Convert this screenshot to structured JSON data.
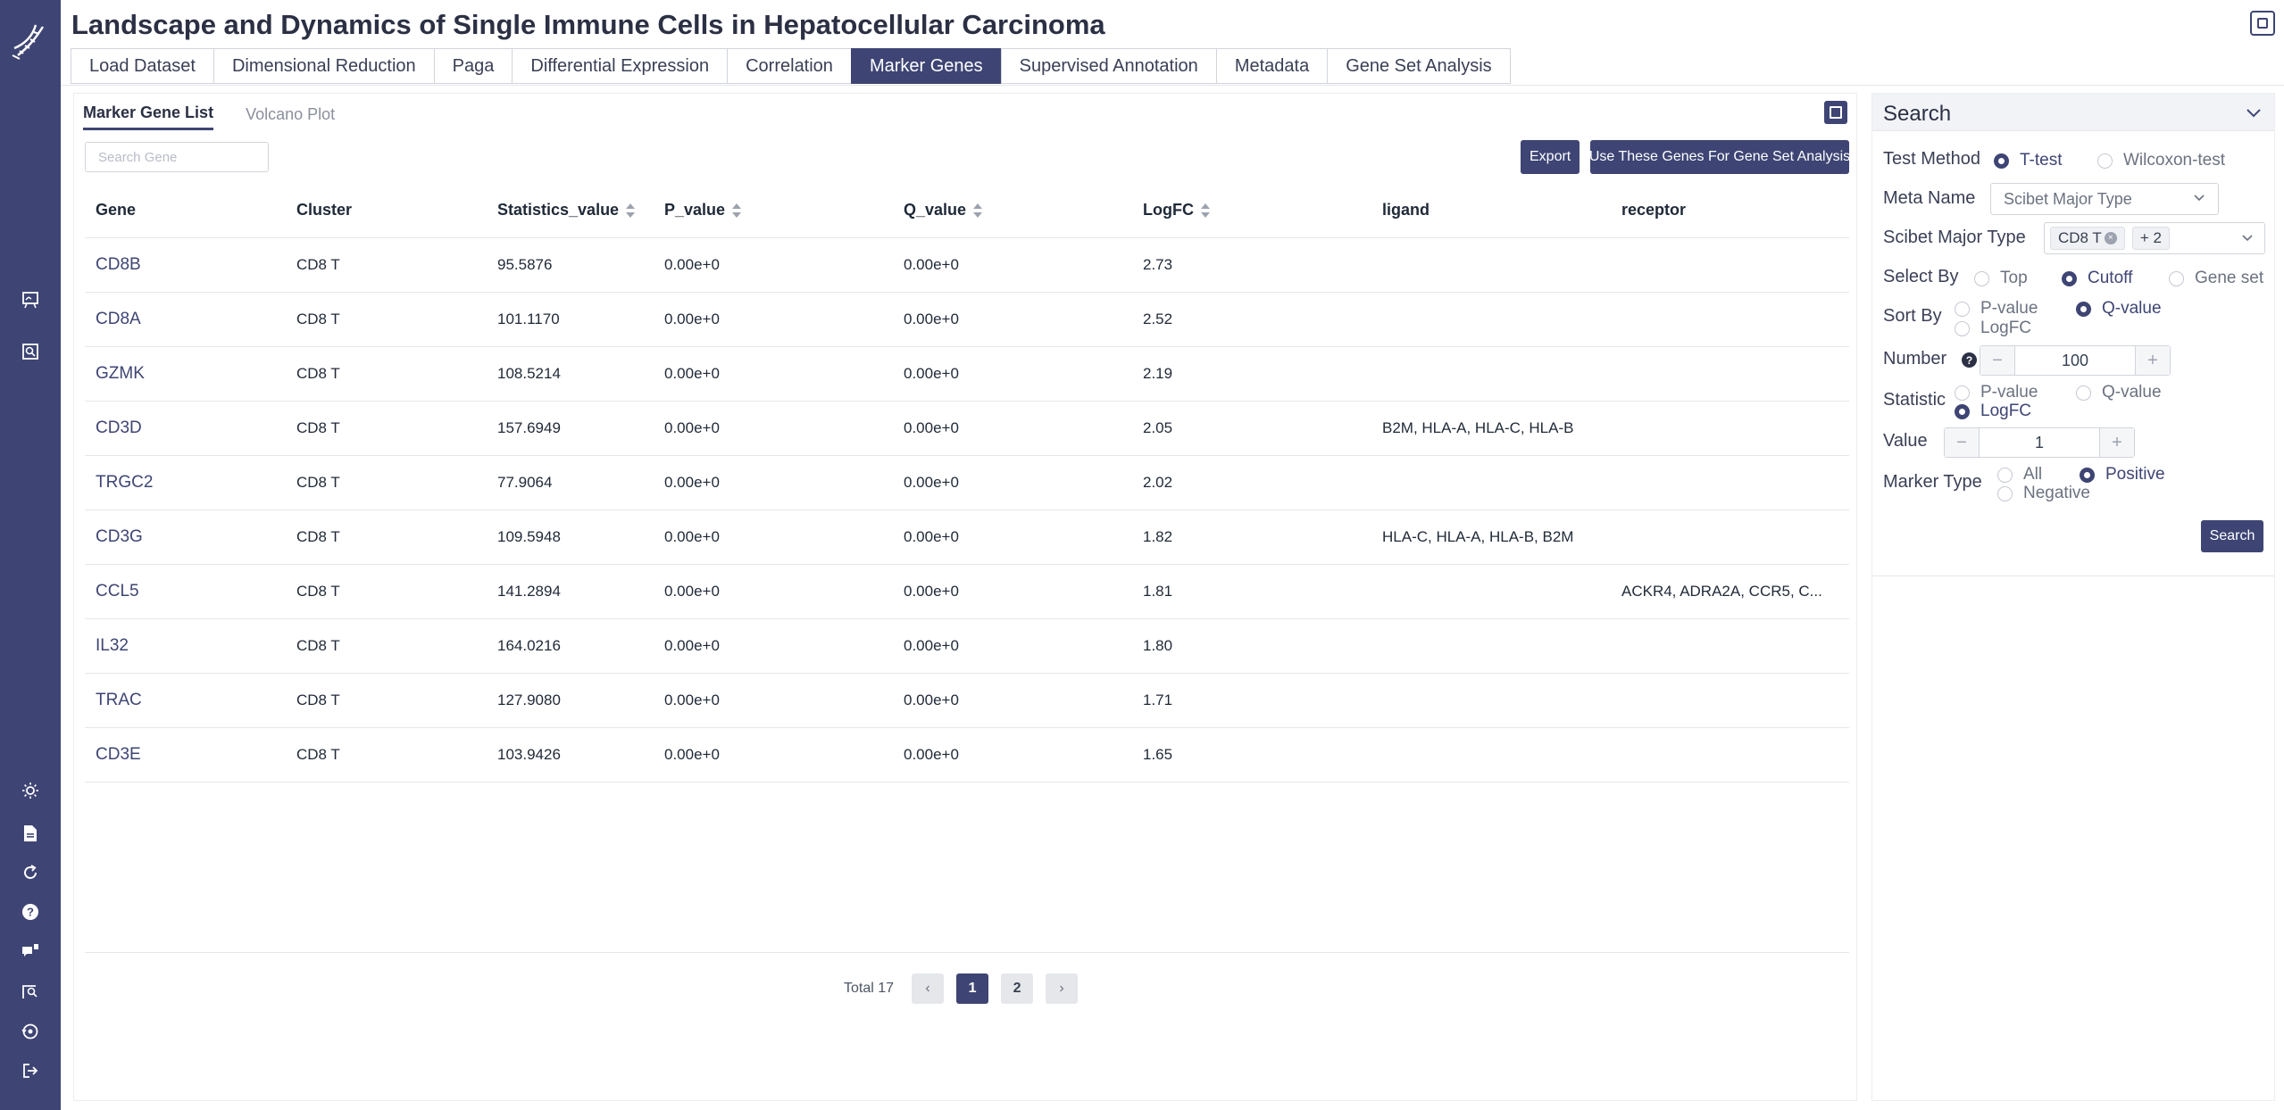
{
  "app": {
    "title": "Landscape and Dynamics of Single Immune Cells in Hepatocellular Carcinoma"
  },
  "tabs": [
    {
      "label": "Load Dataset",
      "active": false
    },
    {
      "label": "Dimensional Reduction",
      "active": false
    },
    {
      "label": "Paga",
      "active": false
    },
    {
      "label": "Differential Expression",
      "active": false
    },
    {
      "label": "Correlation",
      "active": false
    },
    {
      "label": "Marker Genes",
      "active": true
    },
    {
      "label": "Supervised Annotation",
      "active": false
    },
    {
      "label": "Metadata",
      "active": false
    },
    {
      "label": "Gene Set Analysis",
      "active": false
    }
  ],
  "subtabs": [
    {
      "label": "Marker Gene List",
      "active": true
    },
    {
      "label": "Volcano Plot",
      "active": false
    }
  ],
  "toolbar": {
    "search_placeholder": "Search Gene",
    "export_label": "Export",
    "gsa_label": "Use These Genes For Gene Set Analysis"
  },
  "table": {
    "columns": [
      "Gene",
      "Cluster",
      "Statistics_value",
      "P_value",
      "Q_value",
      "LogFC",
      "ligand",
      "receptor"
    ],
    "rows": [
      [
        "CD8B",
        "CD8 T",
        "95.5876",
        "0.00e+0",
        "0.00e+0",
        "2.73",
        "",
        ""
      ],
      [
        "CD8A",
        "CD8 T",
        "101.1170",
        "0.00e+0",
        "0.00e+0",
        "2.52",
        "",
        ""
      ],
      [
        "GZMK",
        "CD8 T",
        "108.5214",
        "0.00e+0",
        "0.00e+0",
        "2.19",
        "",
        ""
      ],
      [
        "CD3D",
        "CD8 T",
        "157.6949",
        "0.00e+0",
        "0.00e+0",
        "2.05",
        "B2M, HLA-A, HLA-C, HLA-B",
        ""
      ],
      [
        "TRGC2",
        "CD8 T",
        "77.9064",
        "0.00e+0",
        "0.00e+0",
        "2.02",
        "",
        ""
      ],
      [
        "CD3G",
        "CD8 T",
        "109.5948",
        "0.00e+0",
        "0.00e+0",
        "1.82",
        "HLA-C, HLA-A, HLA-B, B2M",
        ""
      ],
      [
        "CCL5",
        "CD8 T",
        "141.2894",
        "0.00e+0",
        "0.00e+0",
        "1.81",
        "",
        "ACKR4, ADRA2A, CCR5, C..."
      ],
      [
        "IL32",
        "CD8 T",
        "164.0216",
        "0.00e+0",
        "0.00e+0",
        "1.80",
        "",
        ""
      ],
      [
        "TRAC",
        "CD8 T",
        "127.9080",
        "0.00e+0",
        "0.00e+0",
        "1.71",
        "",
        ""
      ],
      [
        "CD3E",
        "CD8 T",
        "103.9426",
        "0.00e+0",
        "0.00e+0",
        "1.65",
        "",
        ""
      ]
    ]
  },
  "pagination": {
    "total_label": "Total 17",
    "prev": "‹",
    "next": "›",
    "pages": [
      "1",
      "2"
    ],
    "current": "1"
  },
  "search_panel": {
    "title": "Search",
    "test_method": {
      "label": "Test Method",
      "options": [
        "T-test",
        "Wilcoxon-test"
      ],
      "selected": "T-test"
    },
    "meta_name": {
      "label": "Meta Name",
      "value": "Scibet Major Type"
    },
    "scibet_major_type": {
      "label": "Scibet Major Type",
      "tag": "CD8 T",
      "more": "+ 2"
    },
    "select_by": {
      "label": "Select By",
      "options": [
        "Top",
        "Cutoff",
        "Gene set"
      ],
      "selected": "Cutoff"
    },
    "sort_by": {
      "label": "Sort By",
      "options": [
        "P-value",
        "Q-value",
        "LogFC"
      ],
      "selected": "Q-value"
    },
    "number": {
      "label": "Number",
      "value": "100"
    },
    "statistic": {
      "label": "Statistic",
      "options": [
        "P-value",
        "Q-value",
        "LogFC"
      ],
      "selected": "LogFC"
    },
    "value": {
      "label": "Value",
      "value": "1"
    },
    "marker_type": {
      "label": "Marker Type",
      "options": [
        "All",
        "Positive",
        "Negative"
      ],
      "selected": "Positive"
    },
    "search_label": "Search"
  },
  "icons": {
    "sidebar": [
      "presentation-icon",
      "search-doc-icon",
      "sun-icon",
      "document-icon",
      "refresh-icon",
      "help-icon",
      "chat-icon",
      "user-search-icon",
      "history-icon",
      "logout-icon"
    ]
  },
  "colors": {
    "primary": "#3e4574",
    "sidebar_bg": "#3e4574"
  }
}
